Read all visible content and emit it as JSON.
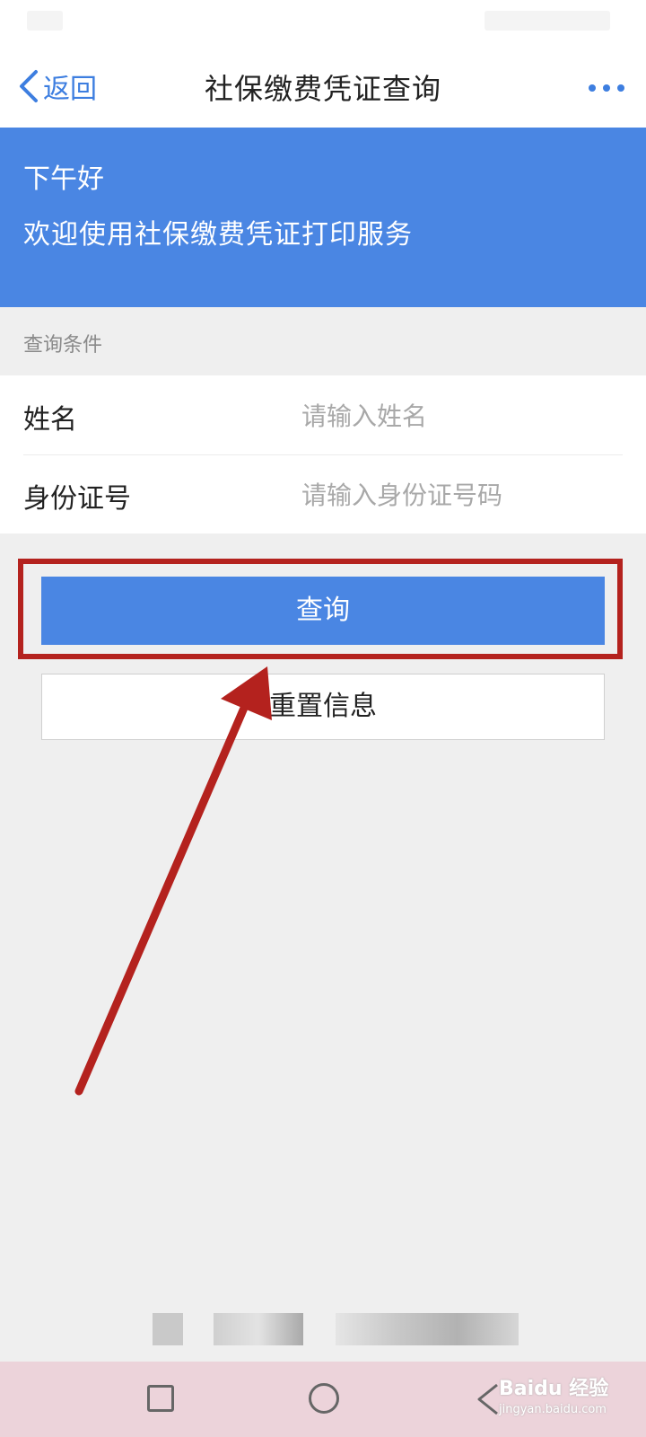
{
  "nav": {
    "back_label": "返回",
    "title": "社保缴费凭证查询"
  },
  "banner": {
    "greeting": "下午好",
    "welcome": "欢迎使用社保缴费凭证打印服务"
  },
  "form": {
    "section_label": "查询条件",
    "fields": [
      {
        "label": "姓名",
        "placeholder": "请输入姓名",
        "value": ""
      },
      {
        "label": "身份证号",
        "placeholder": "请输入身份证号码",
        "value": ""
      }
    ]
  },
  "buttons": {
    "query": "查询",
    "reset": "重置信息"
  },
  "watermark": {
    "brand": "Baidu 经验",
    "url": "jingyan.baidu.com"
  },
  "colors": {
    "primary": "#4a86e3",
    "annotation": "#b4221e"
  }
}
